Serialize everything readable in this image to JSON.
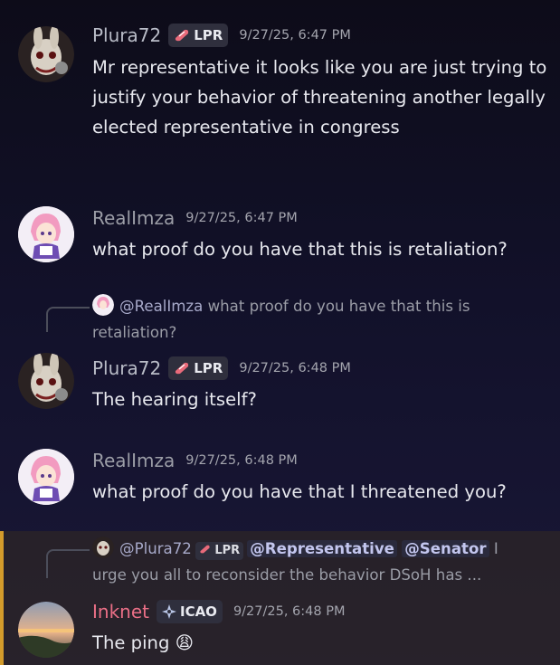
{
  "messages": [
    {
      "username": "Plura72",
      "tag": "LPR",
      "timestamp": "9/27/25, 6:47 PM",
      "text": "Mr representative it looks like you are just trying to justify your behavior of threatening another legally elected representative in congress"
    },
    {
      "username": "RealImza",
      "timestamp": "9/27/25, 6:47 PM",
      "text": "what proof do you have that this is retaliation?"
    },
    {
      "reply": {
        "mention": "@RealImza",
        "text": "what proof do you have that this is retaliation?"
      },
      "username": "Plura72",
      "tag": "LPR",
      "timestamp": "9/27/25, 6:48 PM",
      "text": "The hearing itself?"
    },
    {
      "username": "RealImza",
      "timestamp": "9/27/25, 6:48 PM",
      "text": "what proof do you have that I threatened you?"
    },
    {
      "reply": {
        "mention": "@Plura72",
        "tag": "LPR",
        "mention_role_1": "@Representative",
        "mention_role_2": "@Senator",
        "text": "I urge you all to reconsider the behavior DSoH has ..."
      },
      "username": "Inknet",
      "tag": "ICAO",
      "timestamp": "9/27/25, 6:48 PM",
      "text": "The ping",
      "emoji": "😩"
    }
  ],
  "colors": {
    "plura_name": "#b9bcc7",
    "reall_name": "#9b9da6",
    "inknet_name": "#ea6f86",
    "highlight_bar": "#d39b2b"
  },
  "icons": {
    "lpr_tag": "pink-lung-icon",
    "icao_tag": "compass-icon"
  }
}
